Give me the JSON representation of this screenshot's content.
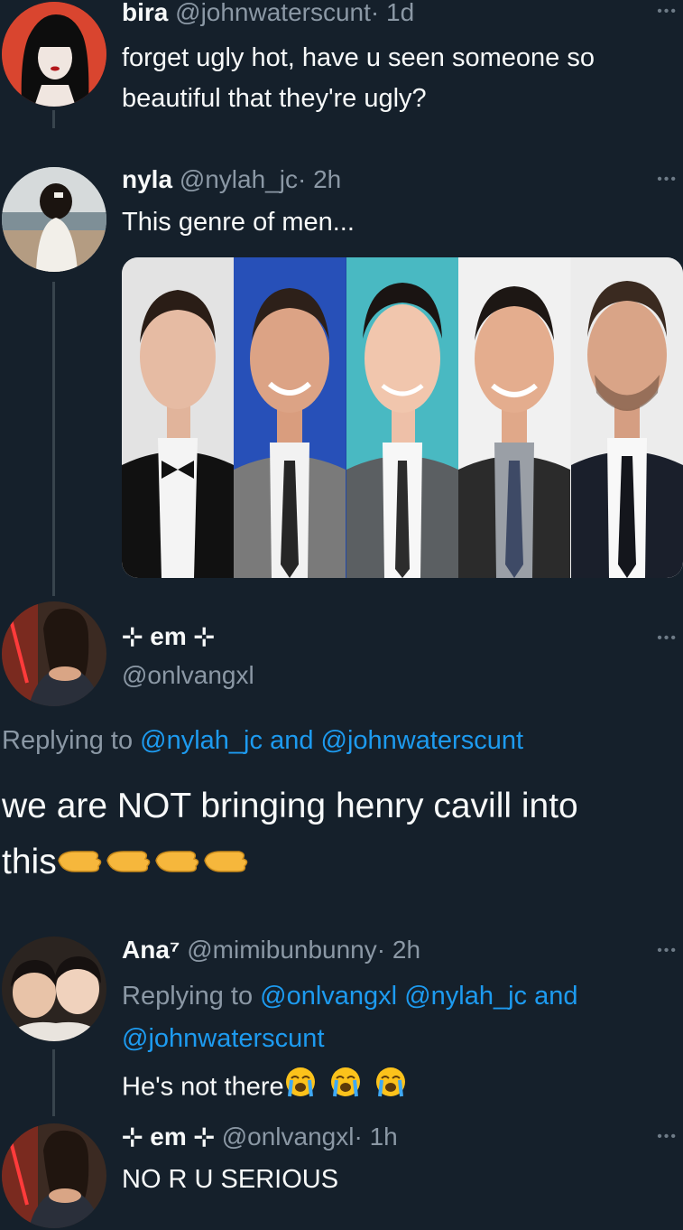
{
  "tweets": [
    {
      "display_name": "bira",
      "handle": "@johnwaterscunt",
      "time": "· 1d",
      "text_line1": "forget ugly hot, have u seen someone so",
      "text_line2": "beautiful that they're ugly?",
      "more_icon": "more-horizontal-icon"
    },
    {
      "display_name": "nyla",
      "handle": "@nylah_jc",
      "time": "· 2h",
      "text": "This genre of men...",
      "media_description_count": 5
    },
    {
      "display_name": "⊹ em ⊹",
      "handle": "@onlvangxl",
      "replying_prefix": "Replying to",
      "replying_to_1": "@nylah_jc",
      "replying_and": "and",
      "replying_to_2": "@johnwaterscunt",
      "text_line1": "we are NOT bringing henry cavill into",
      "text_line2": "this"
    },
    {
      "display_name": "Ana⁷",
      "handle": "@mimibunbunny",
      "time": "· 2h",
      "replying_prefix": "Replying to",
      "replying_to_1": "@onlvangxl",
      "replying_to_2": "@nylah_jc",
      "replying_and": "and",
      "replying_to_3": "@johnwaterscunt",
      "text": "He's not there"
    },
    {
      "display_name": "⊹ em ⊹",
      "handle": "@onlvangxl",
      "time": "· 1h",
      "text": "NO R U SERIOUS"
    }
  ],
  "colors": {
    "background": "#15202b",
    "text": "#f7f9f9",
    "muted": "#8b98a5",
    "link": "#1d9bf0",
    "thread_line": "#38444d"
  }
}
